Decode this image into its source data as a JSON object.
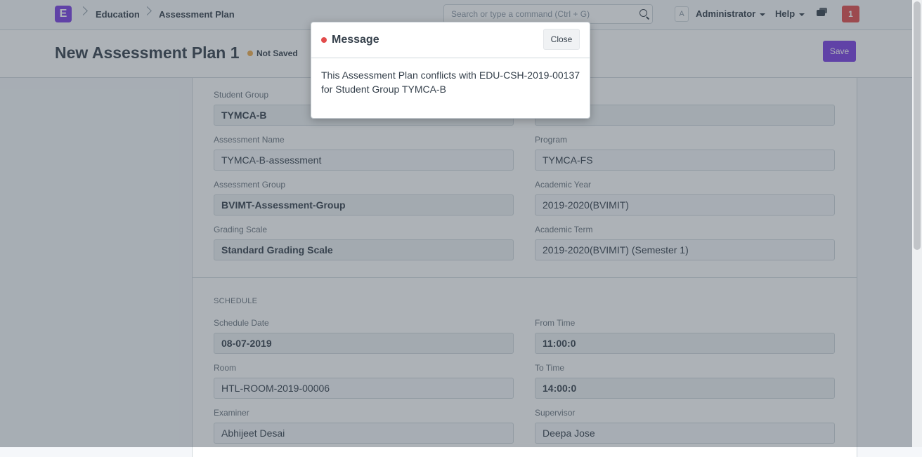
{
  "navbar": {
    "logo_letter": "E",
    "breadcrumbs": [
      "Education",
      "Assessment Plan"
    ],
    "search_placeholder": "Search or type a command (Ctrl + G)",
    "avatar_letter": "A",
    "user_menu": "Administrator",
    "help_menu": "Help",
    "notification_count": "1"
  },
  "page": {
    "title": "New Assessment Plan 1",
    "status": "Not Saved",
    "save_label": "Save"
  },
  "form": {
    "student_group_label": "Student Group",
    "student_group_value": "TYMCA-B",
    "assessment_name_label": "Assessment Name",
    "assessment_name_value": "TYMCA-B-assessment",
    "program_label": "Program",
    "program_value": "TYMCA-FS",
    "assessment_group_label": "Assessment Group",
    "assessment_group_value": "BVIMT-Assessment-Group",
    "academic_year_label": "Academic Year",
    "academic_year_value": "2019-2020(BVIMIT)",
    "grading_scale_label": "Grading Scale",
    "grading_scale_value": "Standard Grading Scale",
    "academic_term_label": "Academic Term",
    "academic_term_value": "2019-2020(BVIMIT) (Semester 1)",
    "schedule_heading": "SCHEDULE",
    "schedule_date_label": "Schedule Date",
    "schedule_date_value": "08-07-2019",
    "from_time_label": "From Time",
    "from_time_value": "11:00:0",
    "room_label": "Room",
    "room_value": "HTL-ROOM-2019-00006",
    "to_time_label": "To Time",
    "to_time_value": "14:00:0",
    "examiner_label": "Examiner",
    "examiner_value": "Abhijeet Desai",
    "supervisor_label": "Supervisor",
    "supervisor_value": "Deepa Jose"
  },
  "modal": {
    "title": "Message",
    "close_label": "Close",
    "body": "This Assessment Plan conflicts with EDU-CSH-2019-00137 for Student Group TYMCA-B"
  },
  "colors": {
    "brand": "#7b3fe4",
    "alert": "#e24c4c",
    "not_saved": "#f0ad4e"
  }
}
